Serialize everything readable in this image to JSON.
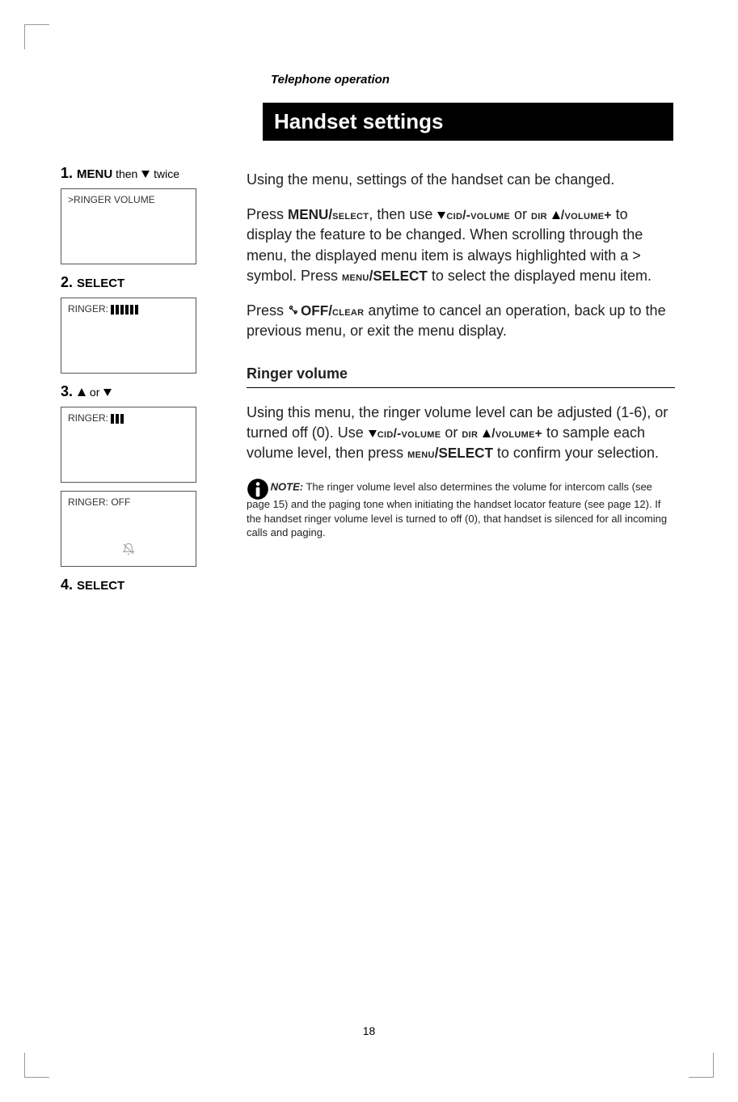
{
  "header": {
    "breadcrumb": "Telephone operation"
  },
  "title": "Handset settings",
  "sidebar": {
    "step1": {
      "num": "1.",
      "btn": "MENU",
      "then": " then ",
      "suffix": " twice",
      "lcd": ">RINGER VOLUME"
    },
    "step2": {
      "num": "2.",
      "btn": "SELECT",
      "lcd_prefix": "RINGER:  "
    },
    "step3": {
      "num": "3.",
      "or": " or ",
      "lcd1_prefix": "RINGER:  ",
      "lcd2": "RINGER:  OFF"
    },
    "step4": {
      "num": "4.",
      "btn": "SELECT"
    }
  },
  "main": {
    "p1": "Using the menu, settings of the handset can be changed.",
    "p2_a": "Press ",
    "p2_menu": "MENU/",
    "p2_select_sc": "select",
    "p2_b": ", then use ",
    "p2_cid": "cid/-volume",
    "p2_or": " or ",
    "p2_dir": "dir",
    "p2_vol": "/volume+",
    "p2_c": " to display the feature to be changed. When scrolling through the menu, the displayed menu item is always highlighted with a > symbol. Press ",
    "p2_menu2_sc": "menu",
    "p2_select2": "/SELECT",
    "p2_d": " to select the displayed menu item.",
    "p3_a": "Press ",
    "p3_off": "OFF/",
    "p3_clear": "clear",
    "p3_b": " anytime to cancel an operation, back up to the previous menu, or exit the menu display.",
    "sub": "Ringer volume",
    "p4_a": "Using this menu, the ringer volume level can be adjusted (1-6), or turned off (0). Use ",
    "p4_cid": "cid/-volume",
    "p4_or": " or ",
    "p4_dir": "dir",
    "p4_vol": "/volume+",
    "p4_b": " to sample each volume level, then press ",
    "p4_menu_sc": "menu",
    "p4_select": "/SELECT",
    "p4_c": " to confirm your selection.",
    "note_label": "NOTE:",
    "note_text": " The ringer volume level also determines the volume for intercom calls (see page 15) and the paging tone when initiating the handset locator feature (see page 12). If the handset ringer volume level is turned to off (0), that handset is silenced for all incoming calls and paging."
  },
  "page_number": "18"
}
